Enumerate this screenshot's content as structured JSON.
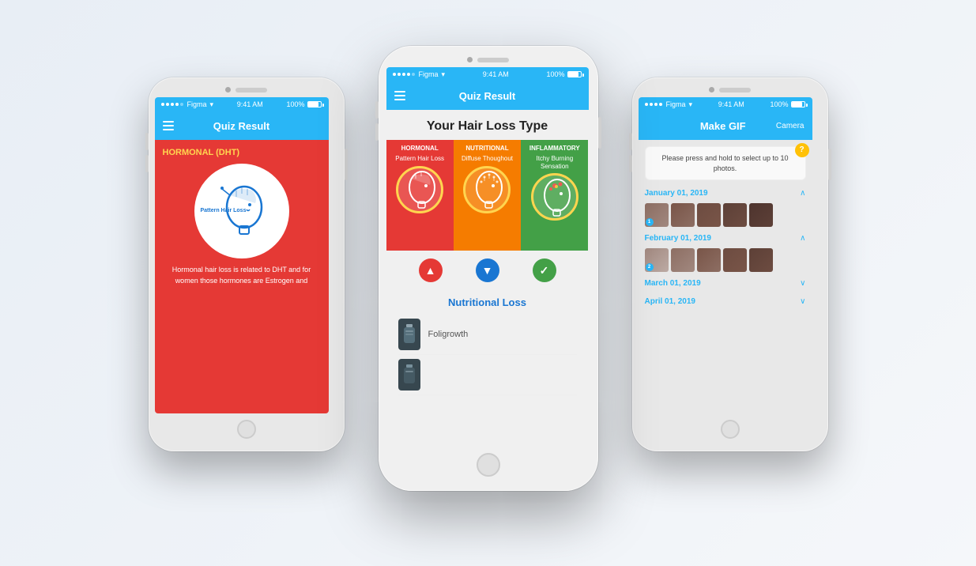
{
  "app": {
    "title": "Quiz Result",
    "makeGifTitle": "Make GIF",
    "cameraLabel": "Camera"
  },
  "statusBar": {
    "carrier": "Figma",
    "time": "9:41 AM",
    "signal": "100%"
  },
  "centerPhone": {
    "pageTitle": "Your Hair Loss Type",
    "cards": [
      {
        "type": "hormonal",
        "label": "HORMONAL",
        "description": "Pattern\nHair Loss",
        "color": "#e53935"
      },
      {
        "type": "nutritional",
        "label": "NUTRITIONAL",
        "description": "Diffuse\nThoughout",
        "color": "#f57c00"
      },
      {
        "type": "inflammatory",
        "label": "INFLAMMATORY",
        "description": "Itchy\nBurning\nSensation",
        "color": "#43a047"
      }
    ],
    "indicators": [
      "▲",
      "▼",
      "✓"
    ],
    "sectionTitle": "Nutritional Loss",
    "products": [
      {
        "name": "Foligrowth"
      },
      {
        "name": ""
      }
    ]
  },
  "leftPhone": {
    "headerTitle": "Quiz Result",
    "cardTitle": "HORMONAL (DHT)",
    "patternLabel": "Pattern\nHair Loss",
    "description": "Hormonal hair loss  is related to DHT  and for women  those hormones  are Estrogen and"
  },
  "rightPhone": {
    "headerTitle": "Make GIF",
    "cameraLabel": "Camera",
    "instruction": "Please press and hold to select up to 10 photos.",
    "dates": [
      {
        "label": "January 01, 2019",
        "expanded": true,
        "num": "1"
      },
      {
        "label": "February 01, 2019",
        "expanded": true,
        "num": "2"
      },
      {
        "label": "March 01, 2019",
        "expanded": false
      },
      {
        "label": "April 01, 2019",
        "expanded": false
      }
    ]
  }
}
